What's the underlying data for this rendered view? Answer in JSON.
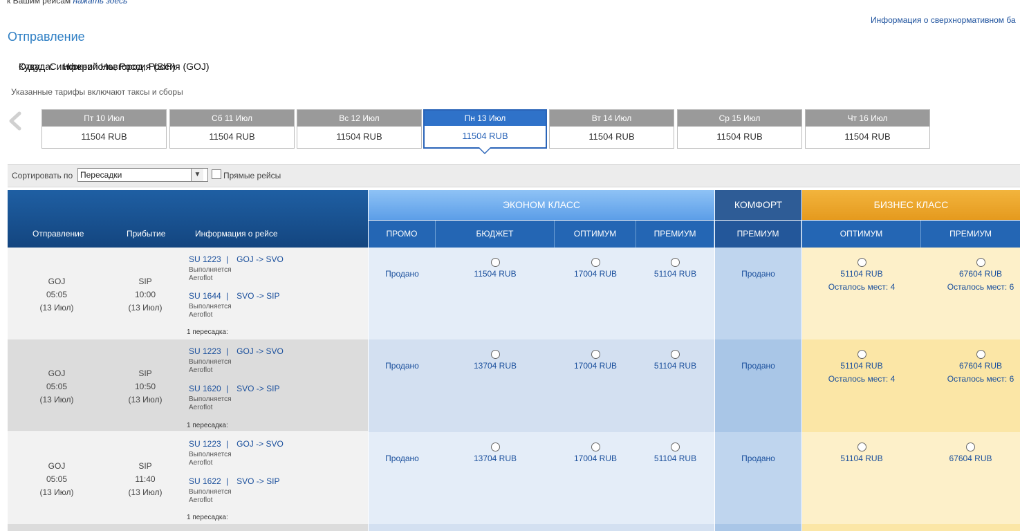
{
  "top_note": {
    "text": "к Вашим рейсам",
    "link": "нажать здесь"
  },
  "baggage_link": "Информация о сверхнормативном ба",
  "page_title": "Отправление",
  "route": {
    "from_label": "Откуда:",
    "from_value": "Нижний Новгород, Россия (GOJ)",
    "to_label": "Куда:",
    "to_value": "Симферополь, Россия (SIP)",
    "tax_note": "Указанные тарифы включают таксы и сборы"
  },
  "dates": [
    {
      "day": "Пт 10 Июл",
      "price": "11504 RUB"
    },
    {
      "day": "Сб 11 Июл",
      "price": "11504 RUB"
    },
    {
      "day": "Вс 12 Июл",
      "price": "11504 RUB"
    },
    {
      "day": "Пн 13 Июл",
      "price": "11504 RUB"
    },
    {
      "day": "Вт 14 Июл",
      "price": "11504 RUB"
    },
    {
      "day": "Ср 15 Июл",
      "price": "11504 RUB"
    },
    {
      "day": "Чт 16 Июл",
      "price": "11504 RUB"
    }
  ],
  "sort": {
    "label": "Сортировать по",
    "selected": "Пересадки",
    "direct_label": "Прямые рейсы"
  },
  "header": {
    "departure": "Отправление",
    "arrival": "Прибытие",
    "flight_info": "Информация о рейсе",
    "economy": "ЭКОНОМ КЛАСС",
    "comfort": "КОМФОРТ",
    "business": "БИЗНЕС КЛАСС",
    "promo": "ПРОМО",
    "budget": "БЮДЖЕТ",
    "optimum": "ОПТИМУМ",
    "premium": "ПРЕМИУМ",
    "comfort_premium": "ПРЕМИУМ",
    "biz_optimum": "ОПТИМУМ",
    "biz_premium": "ПРЕМИУМ"
  },
  "flights": [
    {
      "dep_code": "GOJ",
      "dep_time": "05:05",
      "dep_date": "(13 Июл)",
      "arr_code": "SIP",
      "arr_time": "10:00",
      "arr_date": "(13 Июл)",
      "seg1_code": "SU 1223",
      "seg1_route": "GOJ -> SVO",
      "seg2_code": "SU 1644",
      "seg2_route": "SVO -> SIP",
      "operated": "Выполняется",
      "carrier": "Aeroflot",
      "transfers": "1 пересадка:",
      "promo": "Продано",
      "budget": "11504 RUB",
      "optimum": "17004 RUB",
      "premium": "51104 RUB",
      "comfort": "Продано",
      "biz_optimum": "51104 RUB",
      "biz_optimum_seats": "Осталось мест: 4",
      "biz_premium": "67604 RUB",
      "biz_premium_seats": "Осталось мест: 6"
    },
    {
      "dep_code": "GOJ",
      "dep_time": "05:05",
      "dep_date": "(13 Июл)",
      "arr_code": "SIP",
      "arr_time": "10:50",
      "arr_date": "(13 Июл)",
      "seg1_code": "SU 1223",
      "seg1_route": "GOJ -> SVO",
      "seg2_code": "SU 1620",
      "seg2_route": "SVO -> SIP",
      "operated": "Выполняется",
      "carrier": "Aeroflot",
      "transfers": "1 пересадка:",
      "promo": "Продано",
      "budget": "13704 RUB",
      "optimum": "17004 RUB",
      "premium": "51104 RUB",
      "comfort": "Продано",
      "biz_optimum": "51104 RUB",
      "biz_optimum_seats": "Осталось мест: 4",
      "biz_premium": "67604 RUB",
      "biz_premium_seats": "Осталось мест: 6"
    },
    {
      "dep_code": "GOJ",
      "dep_time": "05:05",
      "dep_date": "(13 Июл)",
      "arr_code": "SIP",
      "arr_time": "11:40",
      "arr_date": "(13 Июл)",
      "seg1_code": "SU 1223",
      "seg1_route": "GOJ -> SVO",
      "seg2_code": "SU 1622",
      "seg2_route": "SVO -> SIP",
      "operated": "Выполняется",
      "carrier": "Aeroflot",
      "transfers": "1 пересадка:",
      "promo": "Продано",
      "budget": "13704 RUB",
      "optimum": "17004 RUB",
      "premium": "51104 RUB",
      "comfort": "Продано",
      "biz_optimum": "51104 RUB",
      "biz_optimum_seats": "",
      "biz_premium": "67604 RUB",
      "biz_premium_seats": ""
    }
  ]
}
